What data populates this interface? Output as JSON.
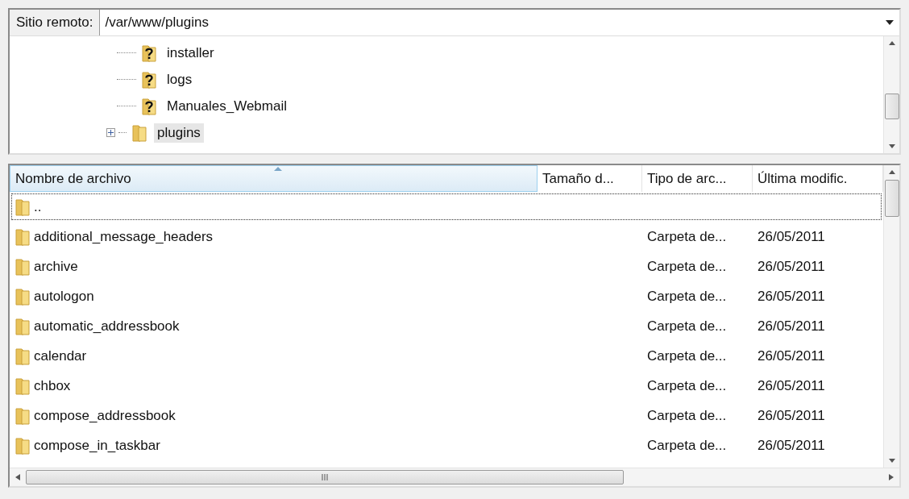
{
  "remote_site": {
    "label": "Sitio remoto:",
    "path": "/var/www/plugins"
  },
  "tree": [
    {
      "name": "installer",
      "kind": "unknown",
      "expandable": false,
      "selected": false
    },
    {
      "name": "logs",
      "kind": "unknown",
      "expandable": false,
      "selected": false
    },
    {
      "name": "Manuales_Webmail",
      "kind": "unknown",
      "expandable": false,
      "selected": false
    },
    {
      "name": "plugins",
      "kind": "folder",
      "expandable": true,
      "selected": true
    }
  ],
  "file_list": {
    "columns": [
      {
        "label": "Nombre de archivo",
        "sorted": true
      },
      {
        "label": "Tamaño d...",
        "sorted": false
      },
      {
        "label": "Tipo de arc...",
        "sorted": false
      },
      {
        "label": "Última modific.",
        "sorted": false
      }
    ],
    "rows": [
      {
        "name": "..",
        "type": "",
        "modified": "",
        "focused": true
      },
      {
        "name": "additional_message_headers",
        "type": "Carpeta de...",
        "modified": "26/05/2011",
        "focused": false
      },
      {
        "name": "archive",
        "type": "Carpeta de...",
        "modified": "26/05/2011",
        "focused": false
      },
      {
        "name": "autologon",
        "type": "Carpeta de...",
        "modified": "26/05/2011",
        "focused": false
      },
      {
        "name": "automatic_addressbook",
        "type": "Carpeta de...",
        "modified": "26/05/2011",
        "focused": false
      },
      {
        "name": "calendar",
        "type": "Carpeta de...",
        "modified": "26/05/2011",
        "focused": false
      },
      {
        "name": "chbox",
        "type": "Carpeta de...",
        "modified": "26/05/2011",
        "focused": false
      },
      {
        "name": "compose_addressbook",
        "type": "Carpeta de...",
        "modified": "26/05/2011",
        "focused": false
      },
      {
        "name": "compose_in_taskbar",
        "type": "Carpeta de...",
        "modified": "26/05/2011",
        "focused": false
      }
    ]
  }
}
